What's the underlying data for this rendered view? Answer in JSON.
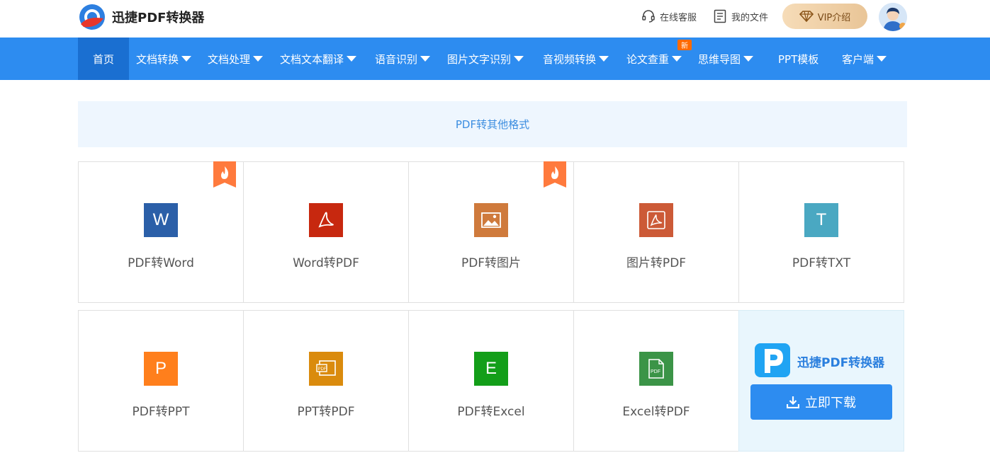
{
  "brand": {
    "name": "迅捷PDF转换器"
  },
  "header": {
    "support": "在线客服",
    "files": "我的文件",
    "vip": "VIP介绍"
  },
  "nav": {
    "items": [
      {
        "label": "首页"
      },
      {
        "label": "文档转换"
      },
      {
        "label": "文档处理"
      },
      {
        "label": "文档文本翻译"
      },
      {
        "label": "语音识别"
      },
      {
        "label": "图片文字识别"
      },
      {
        "label": "音视频转换"
      },
      {
        "label": "论文查重"
      },
      {
        "label": "思维导图"
      },
      {
        "label": "PPT模板"
      },
      {
        "label": "客户端"
      }
    ],
    "new_badge": "新"
  },
  "section": {
    "title": "PDF转其他格式"
  },
  "tools": [
    {
      "label": "PDF转Word",
      "icon": "word-icon",
      "glyph": "W",
      "color": "#2b5fa8"
    },
    {
      "label": "Word转PDF",
      "icon": "acrobat-icon",
      "glyph": "",
      "color": "#c7280f"
    },
    {
      "label": "PDF转图片",
      "icon": "image-icon",
      "glyph": "",
      "color": "#cf7a3c"
    },
    {
      "label": "图片转PDF",
      "icon": "acrobat-icon",
      "glyph": "",
      "color": "#cc5a37"
    },
    {
      "label": "PDF转TXT",
      "icon": "text-icon",
      "glyph": "T",
      "color": "#4aa8c2"
    },
    {
      "label": "PDF转PPT",
      "icon": "powerpoint-icon",
      "glyph": "P",
      "color": "#ff7f1c"
    },
    {
      "label": "PPT转PDF",
      "icon": "ppt-pdf-icon",
      "glyph": "",
      "color": "#da8b0d"
    },
    {
      "label": "PDF转Excel",
      "icon": "excel-icon",
      "glyph": "E",
      "color": "#139e19"
    },
    {
      "label": "Excel转PDF",
      "icon": "excel-pdf-icon",
      "glyph": "",
      "color": "#3b9447"
    }
  ],
  "promo": {
    "title": "迅捷PDF转换器",
    "download": "立即下载"
  },
  "colors": {
    "nav_bg": "#2d8cf0",
    "nav_active": "#1a6fd1",
    "accent": "#2a7fde",
    "hot_badge": "#ff7a3d"
  }
}
